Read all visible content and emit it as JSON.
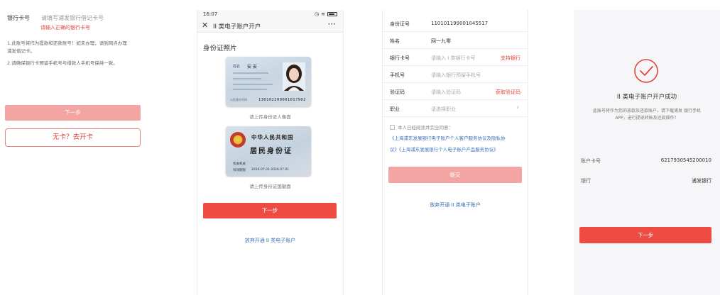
{
  "screen1": {
    "bank_card_label": "银行卡号",
    "bank_card_placeholder": "请填写浦发银行借记卡号",
    "error_text": "请输入正确的银行卡号",
    "note1_line1": "1.此账号将作为提款和还款账号！如未办理，请到网点办理",
    "note1_line2": "浦发借记卡。",
    "note2": "2.请确保银行卡预留手机号与借款人手机号保持一致。",
    "next_button": "下一步",
    "no_card_button": "无卡？去开卡"
  },
  "screen2": {
    "status_time": "16:07",
    "nav_title": "II 类电子账户开户",
    "section_title": "身份证照片",
    "front_caption": "请上传身份证人像面",
    "back_caption": "请上传身份证国徽面",
    "card_front": {
      "name_label": "姓名",
      "name_value": "安 安",
      "id_number": "130102200001017902",
      "logo_text": "公民身份号码"
    },
    "card_back": {
      "country": "中华人民共和国",
      "title": "居民身份证",
      "issuer_label": "签发机关",
      "validity_label": "有效期限",
      "validity_value": "2016.07.01-2026.07.01"
    },
    "next_button": "下一步",
    "giveup_link": "放弃开通 II 类电子账户"
  },
  "screen3": {
    "rows": [
      {
        "label": "身份证号",
        "value": "110101199001045517"
      },
      {
        "label": "姓名",
        "value": "网一九零"
      },
      {
        "label": "银行卡号",
        "placeholder": "请输入 I 类银行卡号",
        "action": "支持银行"
      },
      {
        "label": "手机号",
        "placeholder": "请输入银行预留手机号"
      },
      {
        "label": "验证码",
        "placeholder": "请输入验证码",
        "action": "获取验证码"
      },
      {
        "label": "职业",
        "placeholder": "请选择职业"
      }
    ],
    "agree_text": "本人已经阅读并完全同意：",
    "link_line1": "《上海浦东发展银行电子账户个人客户服务协议及隐私协",
    "link_line2": "议》《上海浦东发展银行个人电子账户产品服务协议》",
    "submit_button": "提交",
    "giveup_link": "放弃开通 II 类电子账户"
  },
  "screen4": {
    "success_title": "II 类电子账户开户成功",
    "desc_line1": "此账号将作为您的放款及还款账户，请下载浦发 银行手机",
    "desc_line2": "APP，进行提现转账及还款操作！",
    "account_label": "账户卡号",
    "account_value": "6217930545200010",
    "bank_label": "银行",
    "bank_value": "浦发银行",
    "next_button": "下一步"
  },
  "colors": {
    "primary_red": "#ee4b43",
    "disabled_red": "#f2a5a3",
    "link_blue": "#3b6fb7"
  }
}
